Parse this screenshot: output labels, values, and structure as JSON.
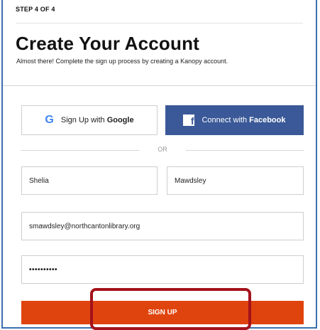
{
  "header": {
    "step": "STEP 4 OF 4",
    "title": "Create Your Account",
    "subtitle": "Almost there! Complete the sign up process by creating a Kanopy account."
  },
  "social": {
    "google_icon": "G",
    "google_label_prefix": "Sign Up with ",
    "google_label_brand": "Google",
    "facebook_icon": "f",
    "facebook_label_prefix": "Connect with ",
    "facebook_label_brand": "Facebook",
    "colors": {
      "facebook": "#3b5998",
      "google_g": "#4285f4"
    }
  },
  "divider": {
    "text": "OR"
  },
  "form": {
    "first_name": "Shelia",
    "last_name": "Mawdsley",
    "email": "smawdsley@northcantonlibrary.org",
    "password_masked": "••••••••••"
  },
  "actions": {
    "signup_label": "SIGN UP",
    "signup_color": "#e0440e",
    "highlight_color": "#a4121b"
  }
}
